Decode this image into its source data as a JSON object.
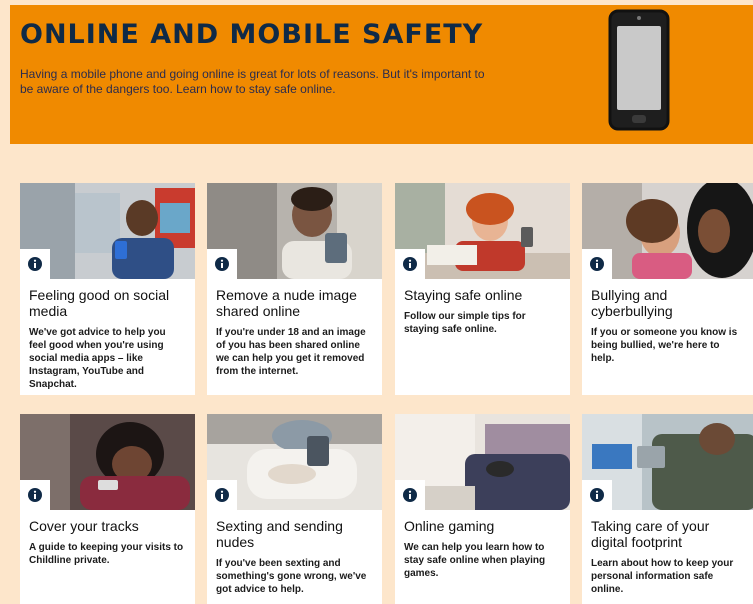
{
  "banner": {
    "title": "ONLINE AND MOBILE SAFETY",
    "description": "Having a mobile phone and going online is great for lots of reasons. But it's important to be aware of the dangers too. Learn how to stay safe online."
  },
  "icons": {
    "phone": "mobile-phone-icon",
    "info": "info-icon"
  },
  "colors": {
    "banner_bg": "#f08a00",
    "page_bg": "#fde6cb",
    "title_color": "#0f2a47",
    "card_bg": "#ffffff"
  },
  "cards": [
    {
      "title": "Feeling good on social media",
      "description": "We've got advice to help you feel good when you're using social media apps – like Instagram, YouTube and Snapchat."
    },
    {
      "title": "Remove a nude image shared online",
      "description": "If you're under 18 and an image of you has been shared online we can help you get it removed from the internet."
    },
    {
      "title": "Staying safe online",
      "description": "Follow our simple tips for staying safe online."
    },
    {
      "title": "Bullying and cyberbullying",
      "description": "If you or someone you know is being bullied, we're here to help."
    },
    {
      "title": "Cover your tracks",
      "description": "A guide to keeping your visits to Childline private."
    },
    {
      "title": "Sexting and sending nudes",
      "description": "If you've been sexting and something's gone wrong, we've got advice to help."
    },
    {
      "title": "Online gaming",
      "description": "We can help you learn how to stay safe online when playing games."
    },
    {
      "title": "Taking care of your digital footprint",
      "description": "Learn about how to keep your personal information safe online."
    }
  ]
}
